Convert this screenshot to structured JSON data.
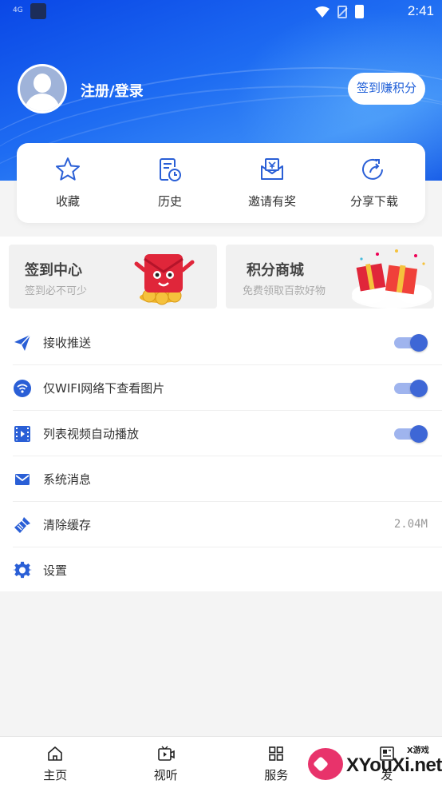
{
  "status_bar": {
    "time": "2:41",
    "left_text": "4G"
  },
  "profile": {
    "login_label": "注册/登录",
    "checkin_button": "签到赚积分"
  },
  "quick_actions": [
    {
      "label": "收藏",
      "icon": "star-icon"
    },
    {
      "label": "历史",
      "icon": "history-icon"
    },
    {
      "label": "邀请有奖",
      "icon": "invite-icon"
    },
    {
      "label": "分享下载",
      "icon": "share-icon"
    }
  ],
  "banners": [
    {
      "title": "签到中心",
      "subtitle": "签到必不可少",
      "icon": "red-envelope-illustration"
    },
    {
      "title": "积分商城",
      "subtitle": "免费领取百款好物",
      "icon": "gift-box-illustration"
    }
  ],
  "settings": [
    {
      "label": "接收推送",
      "icon": "paper-plane-icon",
      "toggle": true
    },
    {
      "label": "仅WIFI网络下查看图片",
      "icon": "wifi-icon",
      "toggle": true
    },
    {
      "label": "列表视频自动播放",
      "icon": "film-icon",
      "toggle": true
    },
    {
      "label": "系统消息",
      "icon": "mail-icon"
    },
    {
      "label": "清除缓存",
      "icon": "broom-icon",
      "value": "2.04M"
    },
    {
      "label": "设置",
      "icon": "gear-icon"
    }
  ],
  "bottom_nav": [
    {
      "label": "主页",
      "icon": "home-icon"
    },
    {
      "label": "视听",
      "icon": "video-icon"
    },
    {
      "label": "服务",
      "icon": "grid-icon"
    },
    {
      "label": "发",
      "icon": "news-icon"
    }
  ],
  "watermark": {
    "small": "X游戏",
    "big": "XYouXi.net"
  },
  "colors": {
    "header": "#1e6cf2",
    "accent": "#1f5fd8",
    "toggle_on": "#3e67d6"
  }
}
